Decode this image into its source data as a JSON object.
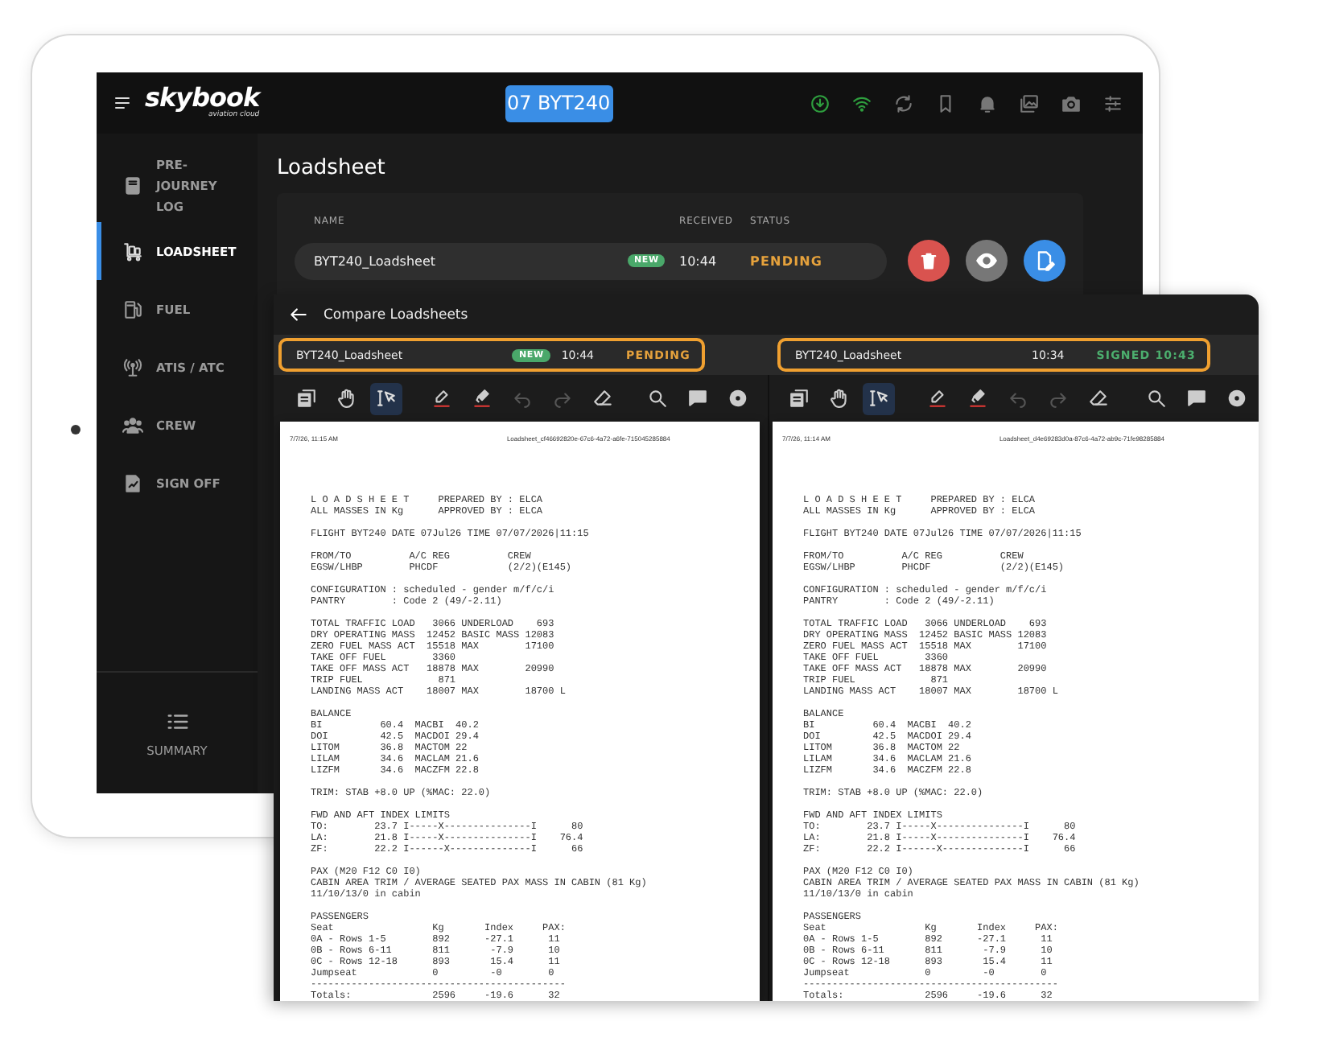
{
  "app": {
    "logo": "skybook",
    "logo_tagline": "aviation cloud",
    "flight_button": "07 BYT240"
  },
  "sidebar": {
    "items": [
      {
        "label": "PRE-JOURNEY LOG",
        "selected": false
      },
      {
        "label": "LOADSHEET",
        "selected": true
      },
      {
        "label": "FUEL",
        "selected": false
      },
      {
        "label": "ATIS / ATC",
        "selected": false
      },
      {
        "label": "CREW",
        "selected": false
      },
      {
        "label": "SIGN OFF",
        "selected": false
      }
    ],
    "summary": "SUMMARY"
  },
  "page": {
    "title": "Loadsheet",
    "table": {
      "columns": [
        "NAME",
        "RECEIVED",
        "STATUS"
      ],
      "rows": [
        {
          "name": "BYT240_Loadsheet",
          "badge": "NEW",
          "received": "10:44",
          "status": "PENDING",
          "kind": "pending"
        }
      ]
    }
  },
  "compare": {
    "title": "Compare Loadsheets",
    "documents": [
      {
        "name": "BYT240_Loadsheet",
        "badge": "NEW",
        "received": "10:44",
        "status": "PENDING",
        "kind": "pending",
        "highlighted": true,
        "tools": [
          {
            "selected": false,
            "disabled": false
          },
          {
            "selected": false,
            "disabled": false
          },
          {
            "selected": true,
            "disabled": false
          },
          {
            "selected": false,
            "disabled": false
          },
          {
            "selected": false,
            "disabled": false
          },
          {
            "selected": false,
            "disabled": true
          },
          {
            "selected": false,
            "disabled": true
          },
          {
            "selected": false,
            "disabled": false
          },
          {
            "selected": false,
            "disabled": false
          },
          {
            "selected": false,
            "disabled": false
          },
          {
            "selected": false,
            "disabled": false
          }
        ],
        "page_header_left": "7/7/26, 11:15 AM",
        "page_header_right": "Loadsheet_cf46692820e-67c6-4a72-a6fe-715045285884",
        "blocks": [
          [
            "L O A D S H E E T     PREPARED BY : ELCA",
            "ALL MASSES IN Kg      APPROVED BY : ELCA"
          ],
          [
            "FLIGHT BYT240 DATE 07Jul26 TIME 07/07/2026|11:15"
          ],
          [
            "FROM/TO          A/C REG          CREW",
            "EGSW/LHBP        PHCDF            (2/2)(E145)"
          ],
          [
            "CONFIGURATION : scheduled - gender m/f/c/i",
            "PANTRY        : Code 2 (49/-2.11)"
          ],
          [
            "TOTAL TRAFFIC LOAD   3066 UNDERLOAD    693",
            "DRY OPERATING MASS  12452 BASIC MASS 12083",
            "ZERO FUEL MASS ACT  15518 MAX        17100",
            "TAKE OFF FUEL        3360",
            "TAKE OFF MASS ACT   18878 MAX        20990",
            "TRIP FUEL             871",
            "LANDING MASS ACT    18007 MAX        18700 L"
          ],
          [
            "BALANCE",
            "BI          60.4  MACBI  40.2",
            "DOI         42.5  MACDOI 29.4",
            "LITOM       36.8  MACTOM 22",
            "LILAM       34.6  MACLAM 21.6",
            "LIZFM       34.6  MACZFM 22.8"
          ],
          [
            "TRIM: STAB +8.0 UP (%MAC: 22.0)"
          ],
          [
            "FWD AND AFT INDEX LIMITS",
            "TO:        23.7 I-----X---------------I      80",
            "LA:        21.8 I-----X---------------I    76.4",
            "ZF:        22.2 I------X--------------I      66"
          ],
          [
            "PAX (M20 F12 C0 I0)",
            "CABIN AREA TRIM / AVERAGE SEATED PAX MASS IN CABIN (81 Kg)",
            "11/10/13/0 in cabin"
          ],
          [
            "PASSENGERS",
            "Seat                 Kg       Index     PAX:",
            "0A - Rows 1-5        892      -27.1      11",
            "0B - Rows 6-11       811       -7.9      10",
            "0C - Rows 12-18      893       15.4      11",
            "Jumpseat             0         -0        0",
            "--------------------------------------------",
            "Totals:              2596     -19.6      32"
          ]
        ]
      },
      {
        "name": "BYT240_Loadsheet",
        "received": "10:34",
        "status": "SIGNED 10:43",
        "kind": "signed",
        "highlighted": true,
        "tools": [
          {
            "selected": false,
            "disabled": false
          },
          {
            "selected": false,
            "disabled": false
          },
          {
            "selected": true,
            "disabled": false
          },
          {
            "selected": false,
            "disabled": false
          },
          {
            "selected": false,
            "disabled": false
          },
          {
            "selected": false,
            "disabled": true
          },
          {
            "selected": false,
            "disabled": true
          },
          {
            "selected": false,
            "disabled": false
          },
          {
            "selected": false,
            "disabled": false
          },
          {
            "selected": false,
            "disabled": false
          },
          {
            "selected": false,
            "disabled": false
          }
        ],
        "page_header_left": "7/7/26, 11:14 AM",
        "page_header_right": "Loadsheet_d4e69283d0a-87c6-4a72-ab9c-71fe98285884",
        "blocks": [
          [
            "L O A D S H E E T     PREPARED BY : ELCA",
            "ALL MASSES IN Kg      APPROVED BY : ELCA"
          ],
          [
            "FLIGHT BYT240 DATE 07Jul26 TIME 07/07/2026|11:15"
          ],
          [
            "FROM/TO          A/C REG          CREW",
            "EGSW/LHBP        PHCDF            (2/2)(E145)"
          ],
          [
            "CONFIGURATION : scheduled - gender m/f/c/i",
            "PANTRY        : Code 2 (49/-2.11)"
          ],
          [
            "TOTAL TRAFFIC LOAD   3066 UNDERLOAD    693",
            "DRY OPERATING MASS  12452 BASIC MASS 12083",
            "ZERO FUEL MASS ACT  15518 MAX        17100",
            "TAKE OFF FUEL        3360",
            "TAKE OFF MASS ACT   18878 MAX        20990",
            "TRIP FUEL             871",
            "LANDING MASS ACT    18007 MAX        18700 L"
          ],
          [
            "BALANCE",
            "BI          60.4  MACBI  40.2",
            "DOI         42.5  MACDOI 29.4",
            "LITOM       36.8  MACTOM 22",
            "LILAM       34.6  MACLAM 21.6",
            "LIZFM       34.6  MACZFM 22.8"
          ],
          [
            "TRIM: STAB +8.0 UP (%MAC: 22.0)"
          ],
          [
            "FWD AND AFT INDEX LIMITS",
            "TO:        23.7 I-----X---------------I      80",
            "LA:        21.8 I-----X---------------I    76.4",
            "ZF:        22.2 I------X--------------I      66"
          ],
          [
            "PAX (M20 F12 C0 I0)",
            "CABIN AREA TRIM / AVERAGE SEATED PAX MASS IN CABIN (81 Kg)",
            "11/10/13/0 in cabin"
          ],
          [
            "PASSENGERS",
            "Seat                 Kg       Index     PAX:",
            "0A - Rows 1-5        892      -27.1      11",
            "0B - Rows 6-11       811       -7.9      10",
            "0C - Rows 12-18      893       15.4      11",
            "Jumpseat             0         -0        0",
            "--------------------------------------------",
            "Totals:              2596     -19.6      32"
          ]
        ]
      }
    ]
  }
}
